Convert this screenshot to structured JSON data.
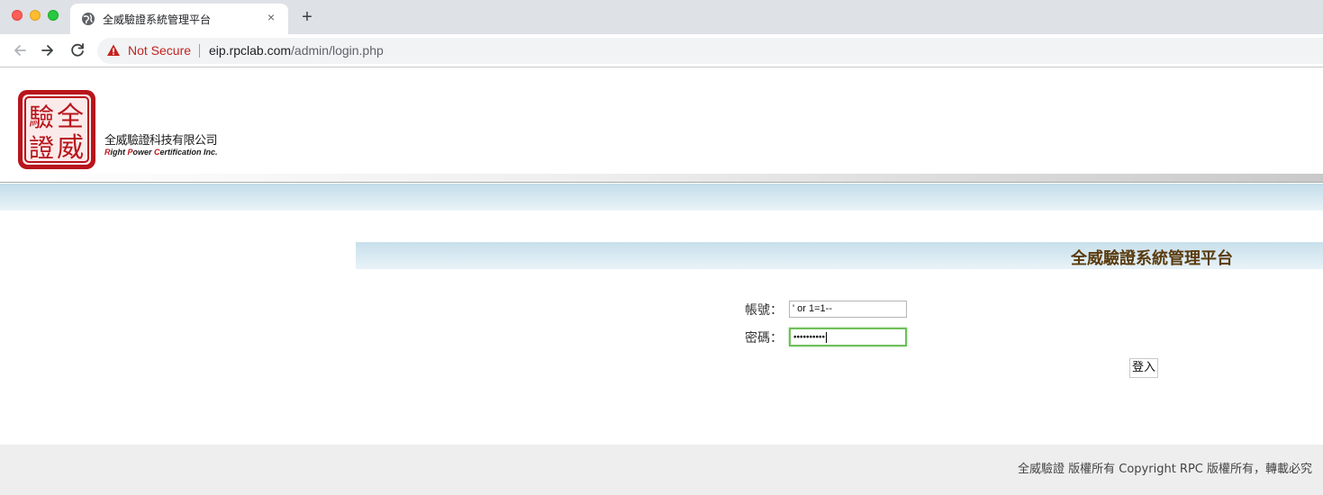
{
  "browser": {
    "tab_title": "全威驗證系統管理平台",
    "tab_close": "×",
    "new_tab": "+",
    "security_label": "Not Secure",
    "url_host": "eip.rpclab.com",
    "url_path": "/admin/login.php",
    "icons": [
      "globe-icon",
      "back-arrow-icon",
      "forward-arrow-icon",
      "reload-icon",
      "warning-icon",
      "close-icon",
      "plus-icon"
    ]
  },
  "header": {
    "seal_chars": [
      "全",
      "驗",
      "威",
      "證"
    ],
    "company_zh": "全威驗證科技有限公司",
    "company_en": {
      "r": "R",
      "ight": "ight ",
      "p": "P",
      "ower": "ower ",
      "c": "C",
      "ertification": "ertification Inc."
    }
  },
  "login": {
    "platform_title": "全威驗證系統管理平台",
    "account_label": "帳號：",
    "account_value": "' or 1=1--",
    "password_label": "密碼：",
    "password_mask": "••••••••••",
    "submit_label": "登入"
  },
  "footer": {
    "copyright": "全威驗證 版權所有 Copyright RPC 版權所有，轉載必究"
  },
  "colors": {
    "title_text": "#5a3b0e",
    "seal_red": "#b8151c",
    "focus_green": "#6fbf5b",
    "band_blue": "#c3dde9",
    "not_secure_red": "#c5221f"
  }
}
